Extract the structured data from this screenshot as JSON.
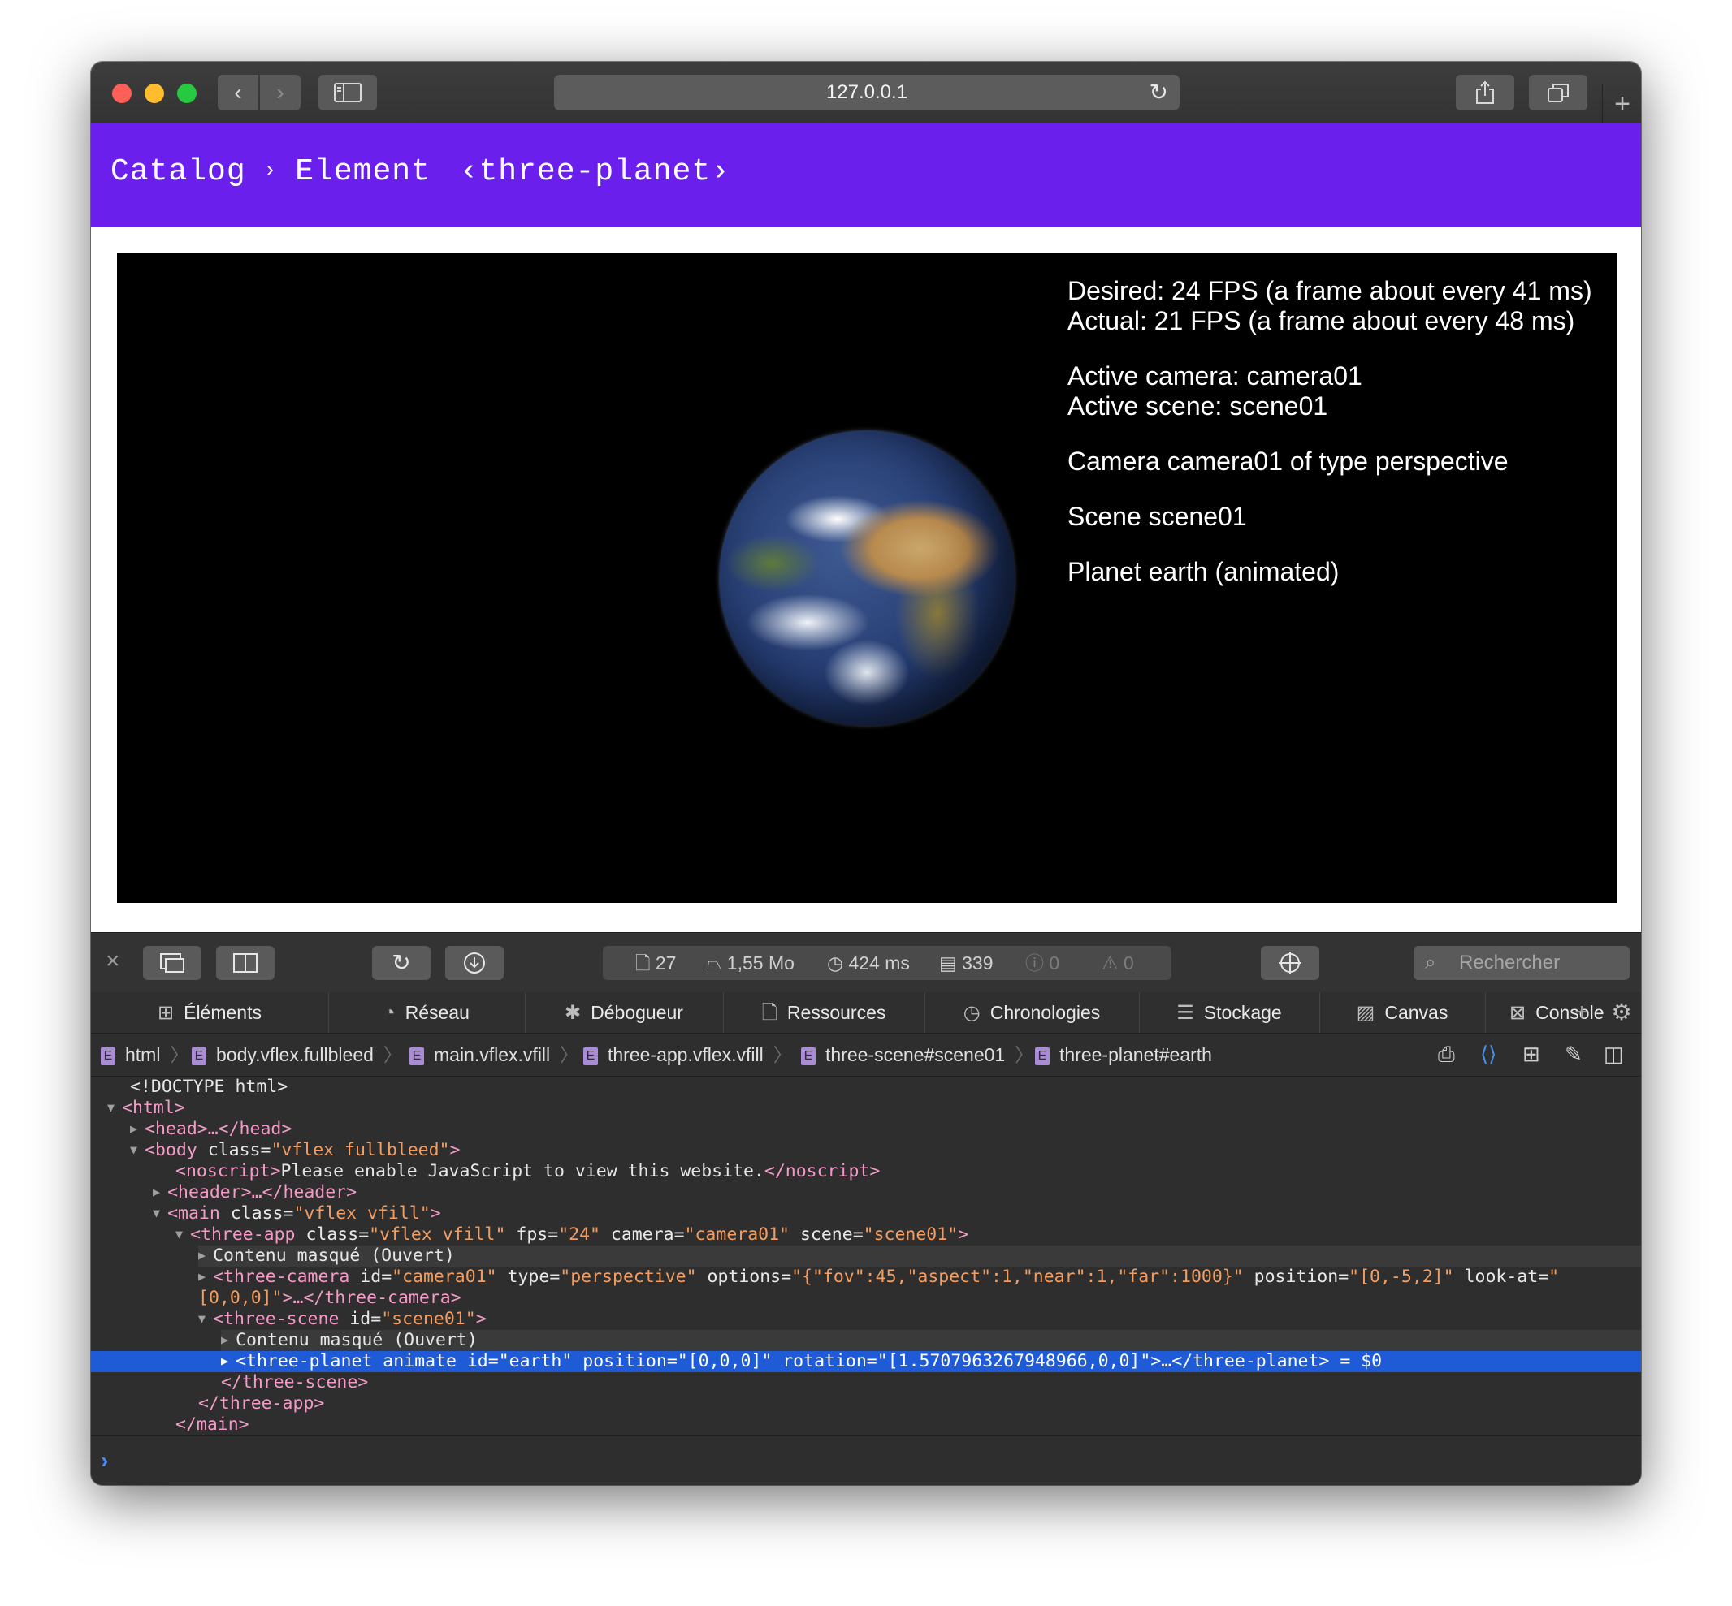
{
  "browser": {
    "url": "127.0.0.1",
    "icons": {
      "back": "chevron-left-icon",
      "forward": "chevron-right-icon",
      "sidebar": "sidebar-icon",
      "reload": "reload-icon",
      "share": "share-icon",
      "tabs": "tabs-overview-icon",
      "new_tab": "plus-icon"
    }
  },
  "page": {
    "breadcrumb": {
      "catalog": "Catalog",
      "sep": "›",
      "element": "Element",
      "current": "‹three-planet›"
    },
    "header_color": "#6b1fed",
    "overlay": {
      "desired": "Desired: 24 FPS (a frame about every 41 ms)",
      "actual": "Actual: 21 FPS (a frame about every 48 ms)",
      "active_camera": "Active camera: camera01",
      "active_scene": "Active scene: scene01",
      "camera_info": "Camera camera01 of type perspective",
      "scene_info": "Scene scene01",
      "planet_info": "Planet earth (animated)"
    }
  },
  "devtools": {
    "stats": {
      "resources": "27",
      "size": "1,55 Mo",
      "time": "424 ms",
      "logs": "339",
      "errors": "0",
      "warnings": "0"
    },
    "search_placeholder": "Rechercher",
    "tabs": [
      {
        "label": "Éléments",
        "icon": "elements-icon"
      },
      {
        "label": "Réseau",
        "icon": "network-icon"
      },
      {
        "label": "Débogueur",
        "icon": "debugger-icon"
      },
      {
        "label": "Ressources",
        "icon": "resources-icon"
      },
      {
        "label": "Chronologies",
        "icon": "timelines-icon"
      },
      {
        "label": "Stockage",
        "icon": "storage-icon"
      },
      {
        "label": "Canvas",
        "icon": "canvas-icon"
      },
      {
        "label": "Console",
        "icon": "console-icon"
      }
    ],
    "path": [
      "html",
      "body.vflex.fullbleed",
      "main.vflex.vfill",
      "three-app.vflex.vfill",
      "three-scene#scene01",
      "three-planet#earth"
    ],
    "dom": {
      "doctype": "<!DOCTYPE html>",
      "html_open": "<html>",
      "head": "<head>…</head>",
      "body_open": "<body",
      "body_attr": "class",
      "body_val": "\"vflex fullbleed\"",
      "noscript_open": "<noscript>",
      "noscript_text": "Please enable JavaScript to view this website.",
      "noscript_close": "</noscript>",
      "header": "<header>…</header>",
      "main_open": "<main",
      "main_attr": "class",
      "main_val": "\"vflex vfill\"",
      "app_open": "<three-app",
      "app_class": "class",
      "app_class_val": "\"vflex vfill\"",
      "app_fps": "fps",
      "app_fps_val": "\"24\"",
      "app_camera": "camera",
      "app_camera_val": "\"camera01\"",
      "app_scene": "scene",
      "app_scene_val": "\"scene01\"",
      "shadow1": "Contenu masqué (Ouvert)",
      "camera_open": "<three-camera",
      "camera_id": "id",
      "camera_id_val": "\"camera01\"",
      "camera_type": "type",
      "camera_type_val": "\"perspective\"",
      "camera_options": "options",
      "camera_options_val": "\"{\"fov\":45,\"aspect\":1,\"near\":1,\"far\":1000}\"",
      "camera_position": "position",
      "camera_position_val": "\"[0,-5,2]\"",
      "camera_lookat": "look-at",
      "camera_lookat_val": "\"[0,0,0]\"",
      "camera_close": "…</three-camera>",
      "scene_open": "<three-scene",
      "scene_id": "id",
      "scene_id_val": "\"scene01\"",
      "shadow2": "Contenu masqué (Ouvert)",
      "planet_open": "<three-planet",
      "planet_animate": "animate",
      "planet_id": "id",
      "planet_id_val": "\"earth\"",
      "planet_position": "position",
      "planet_position_val": "\"[0,0,0]\"",
      "planet_rotation": "rotation",
      "planet_rotation_val": "\"[1.5707963267948966,0,0]\"",
      "planet_close": "…</three-planet>",
      "planet_ref": "= $0",
      "scene_close": "</three-scene>",
      "app_close": "</three-app>",
      "main_close": "</main>"
    }
  }
}
